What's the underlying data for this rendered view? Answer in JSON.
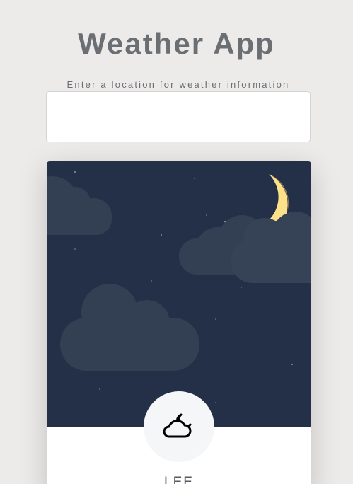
{
  "app": {
    "title": "Weather App"
  },
  "search": {
    "label": "Enter a location for weather information",
    "value": "",
    "placeholder": ""
  },
  "weather": {
    "condition_icon": "cloud-moon-icon",
    "scene": "night-sky-with-moon-and-clouds",
    "location": "LEE"
  },
  "colors": {
    "background": "#edebe9",
    "sky": "#243047",
    "cloud": "#333f52",
    "moon": "#fde08a",
    "text": "#6b6f73"
  }
}
